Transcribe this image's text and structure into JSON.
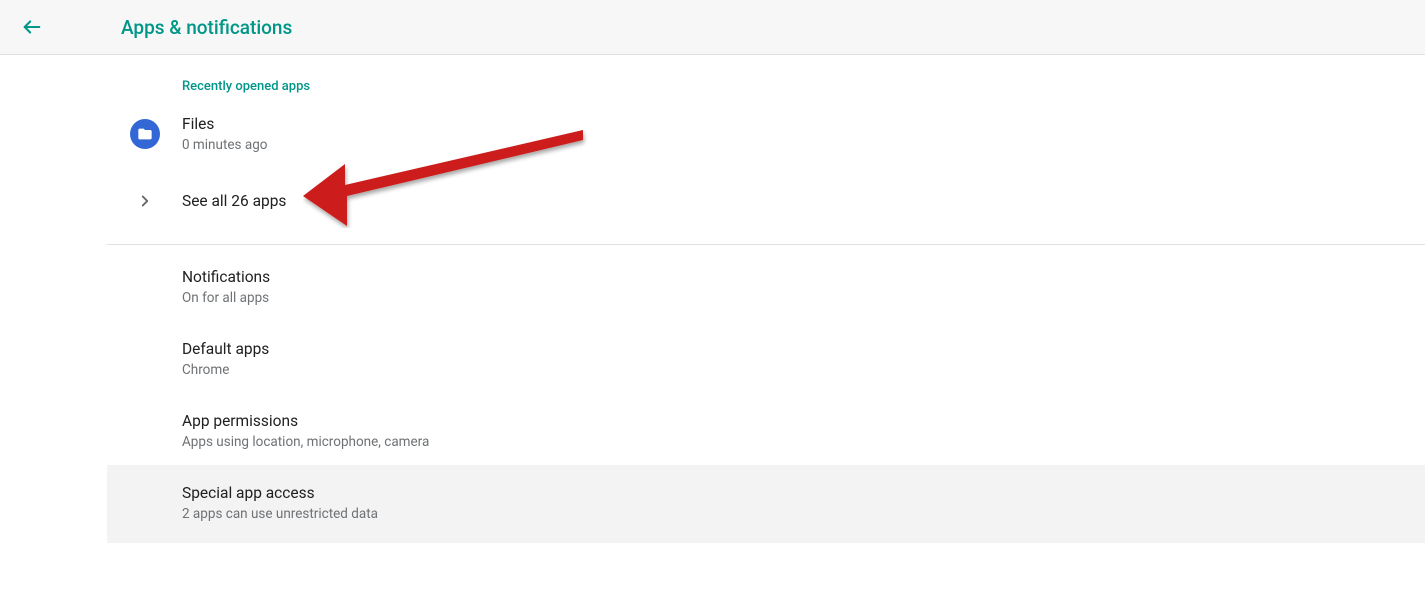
{
  "header": {
    "title": "Apps & notifications"
  },
  "section_header": "Recently opened apps",
  "recent_app": {
    "name": "Files",
    "subtitle": "0 minutes ago"
  },
  "see_all": {
    "label": "See all 26 apps"
  },
  "items": [
    {
      "title": "Notifications",
      "subtitle": "On for all apps"
    },
    {
      "title": "Default apps",
      "subtitle": "Chrome"
    },
    {
      "title": "App permissions",
      "subtitle": "Apps using location, microphone, camera"
    },
    {
      "title": "Special app access",
      "subtitle": "2 apps can use unrestricted data"
    }
  ]
}
